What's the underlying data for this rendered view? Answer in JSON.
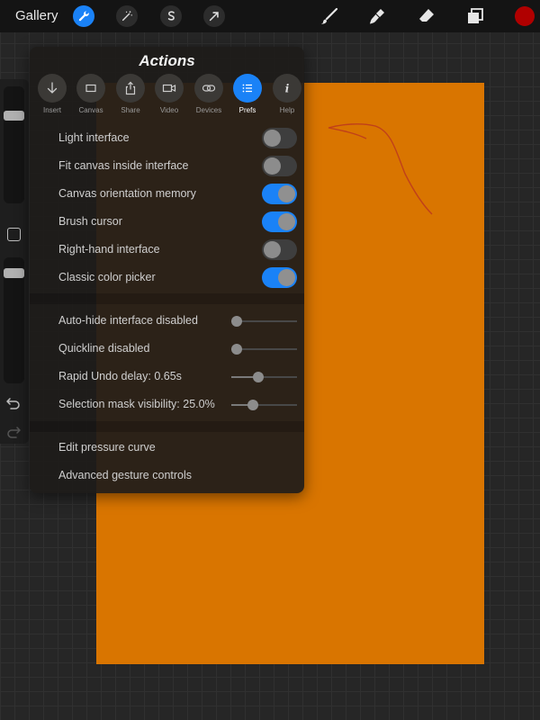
{
  "topbar": {
    "gallery_label": "Gallery",
    "buttons": [
      {
        "name": "wrench-icon",
        "active": true
      },
      {
        "name": "magic-wand-icon",
        "active": false
      },
      {
        "name": "selection-s-icon",
        "active": false
      },
      {
        "name": "transform-arrow-icon",
        "active": false
      }
    ],
    "tools": [
      "brush-icon",
      "smudge-icon",
      "eraser-icon",
      "layers-icon"
    ],
    "current_color": "#b00000"
  },
  "canvas": {
    "color": "#d97500",
    "stroke_color": "#c0401a"
  },
  "sidebar": {
    "size_level": 0.2,
    "opacity_level": 0.05,
    "icons": [
      "modify-square-icon",
      "undo-icon",
      "redo-icon"
    ]
  },
  "panel": {
    "title": "Actions",
    "tabs": [
      {
        "label": "Insert",
        "icon": "arrow-down-icon",
        "active": false
      },
      {
        "label": "Canvas",
        "icon": "rectangle-icon",
        "active": false
      },
      {
        "label": "Share",
        "icon": "share-icon",
        "active": false
      },
      {
        "label": "Video",
        "icon": "video-camera-icon",
        "active": false
      },
      {
        "label": "Devices",
        "icon": "link-icon",
        "active": false
      },
      {
        "label": "Prefs",
        "icon": "list-icon",
        "active": true
      },
      {
        "label": "Help",
        "icon": "info-icon",
        "active": false
      }
    ],
    "toggles": [
      {
        "label": "Light interface",
        "on": false
      },
      {
        "label": "Fit canvas inside interface",
        "on": false
      },
      {
        "label": "Canvas orientation memory",
        "on": true
      },
      {
        "label": "Brush cursor",
        "on": true
      },
      {
        "label": "Right-hand interface",
        "on": false
      },
      {
        "label": "Classic color picker",
        "on": true
      }
    ],
    "sliders": [
      {
        "label": "Auto-hide interface disabled",
        "value": 0.0
      },
      {
        "label": "Quickline disabled",
        "value": 0.0
      },
      {
        "label": "Rapid Undo delay: 0.65s",
        "value": 0.4
      },
      {
        "label": "Selection mask visibility: 25.0%",
        "value": 0.3
      }
    ],
    "links": [
      {
        "label": "Edit pressure curve"
      },
      {
        "label": "Advanced gesture controls"
      }
    ]
  },
  "accent_color": "#1a82f7"
}
